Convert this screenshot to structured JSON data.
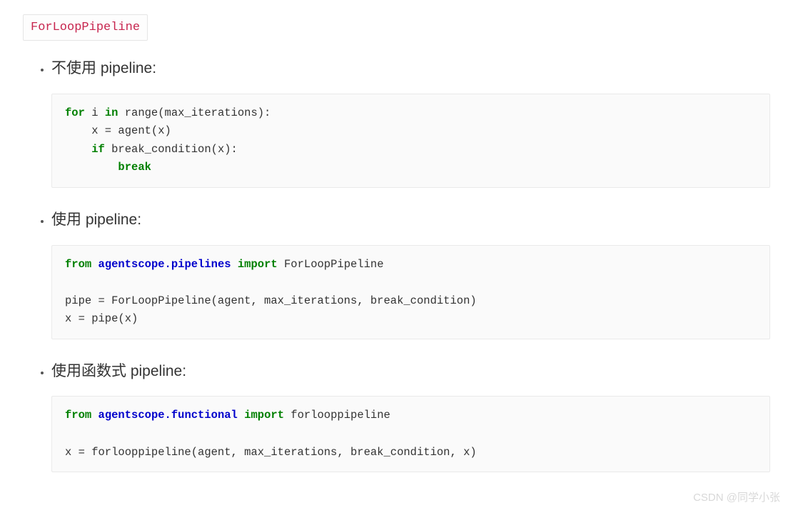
{
  "title_tag": "ForLoopPipeline",
  "sections": [
    {
      "heading": "不使用 pipeline:",
      "code_tokens": [
        {
          "t": "for",
          "c": "kw"
        },
        {
          "t": " i "
        },
        {
          "t": "in",
          "c": "kw"
        },
        {
          "t": " range(max_iterations):\n    x = agent(x)\n    "
        },
        {
          "t": "if",
          "c": "kw"
        },
        {
          "t": " break_condition(x):\n        "
        },
        {
          "t": "break",
          "c": "kw"
        }
      ]
    },
    {
      "heading": "使用 pipeline:",
      "code_tokens": [
        {
          "t": "from",
          "c": "kw"
        },
        {
          "t": " "
        },
        {
          "t": "agentscope.pipelines",
          "c": "mod"
        },
        {
          "t": " "
        },
        {
          "t": "import",
          "c": "kw"
        },
        {
          "t": " ForLoopPipeline\n\npipe = ForLoopPipeline(agent, max_iterations, break_condition)\nx = pipe(x)"
        }
      ]
    },
    {
      "heading": "使用函数式 pipeline:",
      "code_tokens": [
        {
          "t": "from",
          "c": "kw"
        },
        {
          "t": " "
        },
        {
          "t": "agentscope.functional",
          "c": "mod"
        },
        {
          "t": " "
        },
        {
          "t": "import",
          "c": "kw"
        },
        {
          "t": " forlooppipeline\n\nx = forlooppipeline(agent, max_iterations, break_condition, x)"
        }
      ]
    }
  ],
  "watermark": "CSDN @同学小张"
}
